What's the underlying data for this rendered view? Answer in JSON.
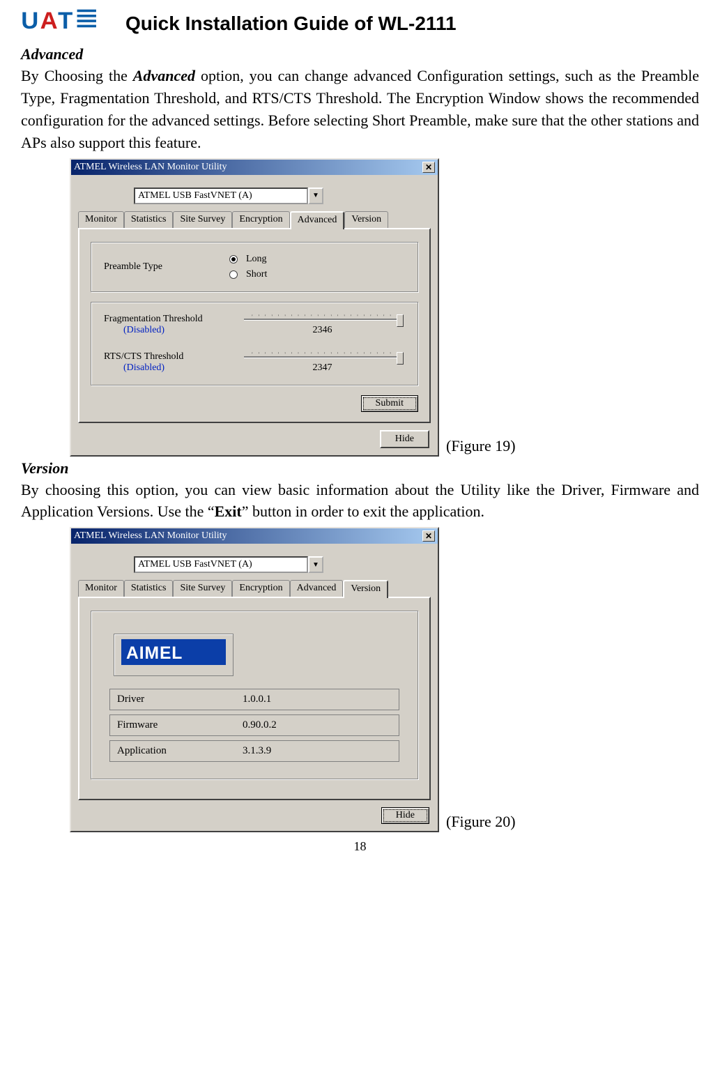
{
  "header": {
    "title": "Quick Installation Guide of WL-2111"
  },
  "section1": {
    "title": "Advanced",
    "text_a": "By Choosing the ",
    "text_b": "Advanced",
    "text_c": " option, you can change advanced Configuration settings, such as the Preamble Type, Fragmentation Threshold, and RTS/CTS Threshold.  The Encryption Window shows the recommended configuration for the advanced settings. Before selecting Short Preamble, make sure that the other stations and APs also support this feature."
  },
  "figure1": {
    "caption": "(Figure 19)",
    "window_title": "ATMEL Wireless LAN Monitor Utility",
    "device": "ATMEL USB FastVNET (A)",
    "tabs": [
      "Monitor",
      "Statistics",
      "Site Survey",
      "Encryption",
      "Advanced",
      "Version"
    ],
    "active_tab": "Advanced",
    "preamble_label": "Preamble Type",
    "radio_long": "Long",
    "radio_short": "Short",
    "frag_label": "Fragmentation Threshold",
    "frag_disabled": "(Disabled)",
    "frag_value": "2346",
    "rts_label": "RTS/CTS Threshold",
    "rts_disabled": "(Disabled)",
    "rts_value": "2347",
    "submit": "Submit",
    "hide": "Hide"
  },
  "section2": {
    "title": "Version",
    "text_a": "By choosing this option, you can view basic information about the Utility like the Driver, Firmware and Application Versions. Use the “",
    "text_b": "Exit",
    "text_c": "” button in order to exit the application."
  },
  "figure2": {
    "caption": "(Figure 20)",
    "window_title": "ATMEL Wireless LAN Monitor Utility",
    "device": "ATMEL USB FastVNET (A)",
    "tabs": [
      "Monitor",
      "Statistics",
      "Site Survey",
      "Encryption",
      "Advanced",
      "Version"
    ],
    "active_tab": "Version",
    "logo_text": "ATMEL",
    "rows": [
      {
        "k": "Driver",
        "v": "1.0.0.1"
      },
      {
        "k": "Firmware",
        "v": "0.90.0.2"
      },
      {
        "k": "Application",
        "v": "3.1.3.9"
      }
    ],
    "hide": "Hide"
  },
  "page_number": "18"
}
